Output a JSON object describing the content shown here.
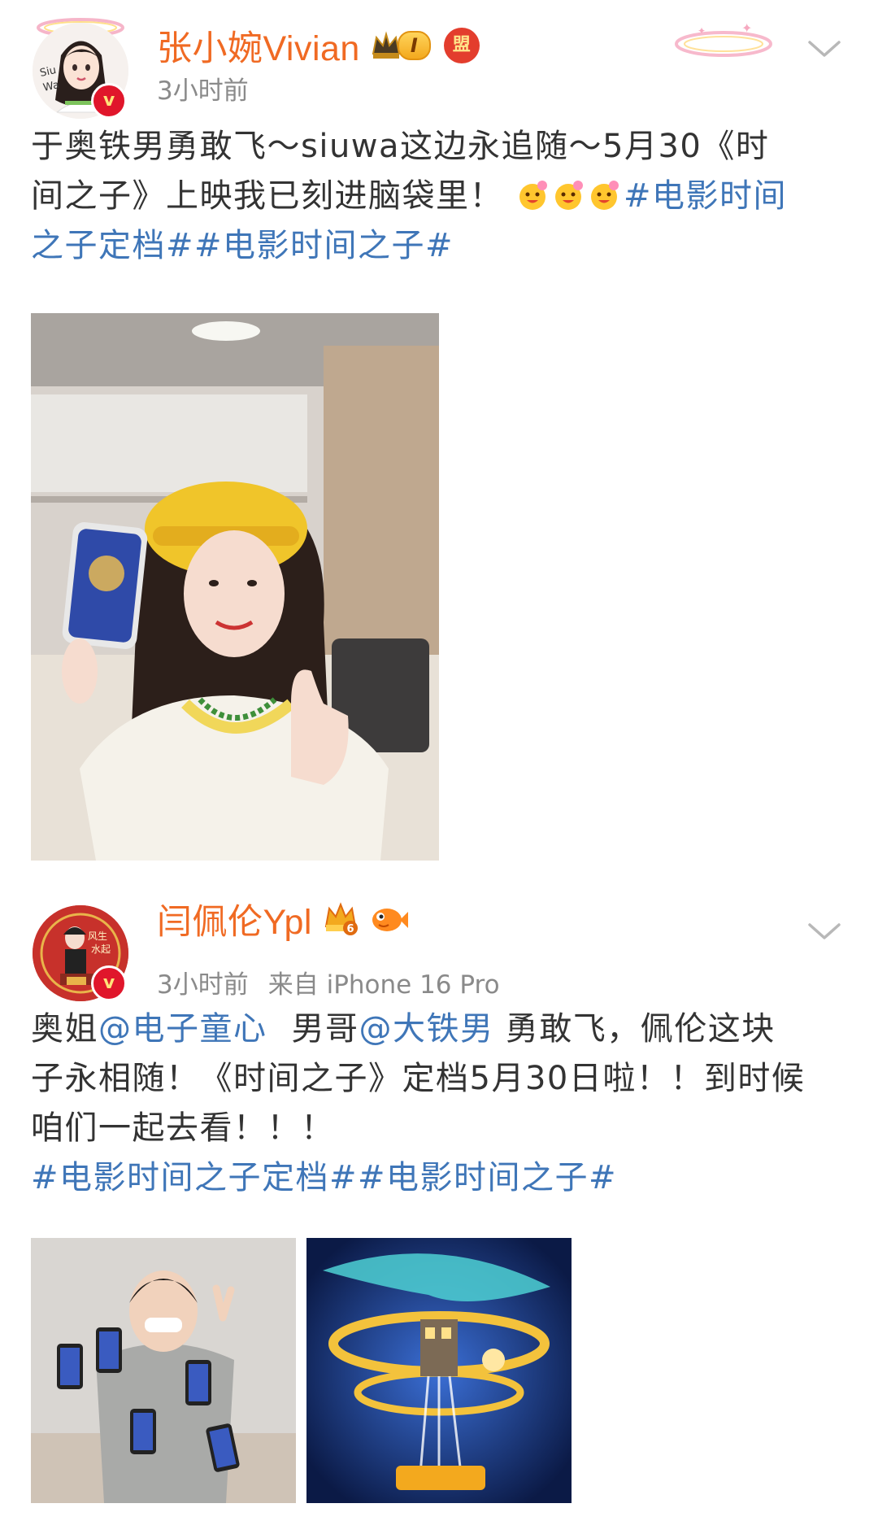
{
  "posts": [
    {
      "user_name": "张小婉Vivian",
      "avatar_text": "Siu Wa",
      "rank_level": "I",
      "extra_badge": "盟",
      "verify_mark": "v",
      "time": "3小时前",
      "text_lines": [
        [
          "于奥铁男勇敢飞～siuwa这边永追随～5月30《时"
        ],
        [
          "间之子》上映我已刻进脑袋里！"
        ],
        [
          "之子定档##电影时间之子#"
        ]
      ],
      "line2_topic": "#电影时间",
      "emojis": [
        "smile-flower-emoji",
        "smile-flower-emoji",
        "smile-flower-emoji"
      ],
      "image": "selfie-with-phone-photo"
    },
    {
      "user_name": "闫佩伦Ypl",
      "avatar_text": "风生水起",
      "rank_level": "6",
      "verify_mark": "v",
      "time": "3小时前",
      "source": "来自 iPhone 16 Pro",
      "text": {
        "prefix": "奥姐",
        "mention1": "@电子童心",
        "mid": "男哥",
        "mention2": "@大铁男",
        "suffix": " 勇敢飞，佩伦这块",
        "line2": "子永相随！《时间之子》定档5月30日啦！！到时候",
        "line3": "咱们一起去看！！！",
        "topics": "#电影时间之子定档##电影时间之子#"
      },
      "images": [
        "man-holding-phones-photo",
        "movie-poster-artwork"
      ]
    }
  ],
  "colors": {
    "username": "#f06a23",
    "link": "#3f76b8",
    "meta": "#8a8a8a",
    "body_text": "#333333"
  }
}
